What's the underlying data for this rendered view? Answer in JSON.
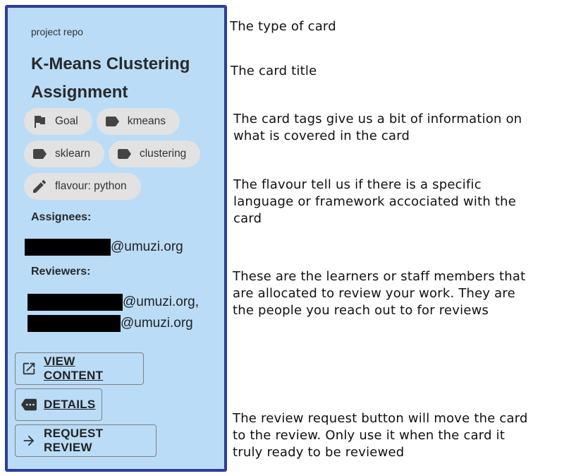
{
  "card": {
    "type": "project repo",
    "title": "K-Means Clustering Assignment",
    "tags": [
      {
        "icon": "flag-icon",
        "label": "Goal"
      },
      {
        "icon": "label-icon",
        "label": "kmeans"
      },
      {
        "icon": "label-icon",
        "label": "sklearn"
      },
      {
        "icon": "label-icon",
        "label": "clustering"
      },
      {
        "icon": "pencil-icon",
        "label": "flavour: python"
      }
    ],
    "assignees_label": "Assignees:",
    "assignees": [
      "@umuzi.org"
    ],
    "reviewers_label": "Reviewers:",
    "reviewers": [
      "@umuzi.org,",
      "@umuzi.org"
    ],
    "buttons": {
      "view_content": "VIEW CONTENT",
      "details": "DETAILS",
      "request_review": "REQUEST REVIEW"
    }
  },
  "annotations": {
    "type": "The type of card",
    "title": "The card title",
    "tags": [
      "The card tags give us a bit of information on",
      "what is covered in the card"
    ],
    "flavour": [
      "The flavour tell us if there is a specific",
      "language or framework accociated with the",
      "card"
    ],
    "reviewers": [
      "These are the learners or staff members that",
      "are allocated to review your work. They are",
      "the people you reach out to for reviews"
    ],
    "review_button": [
      "The review request button will move the card",
      "to the review. Only use it when the card it",
      "truly ready to be reviewed"
    ]
  }
}
